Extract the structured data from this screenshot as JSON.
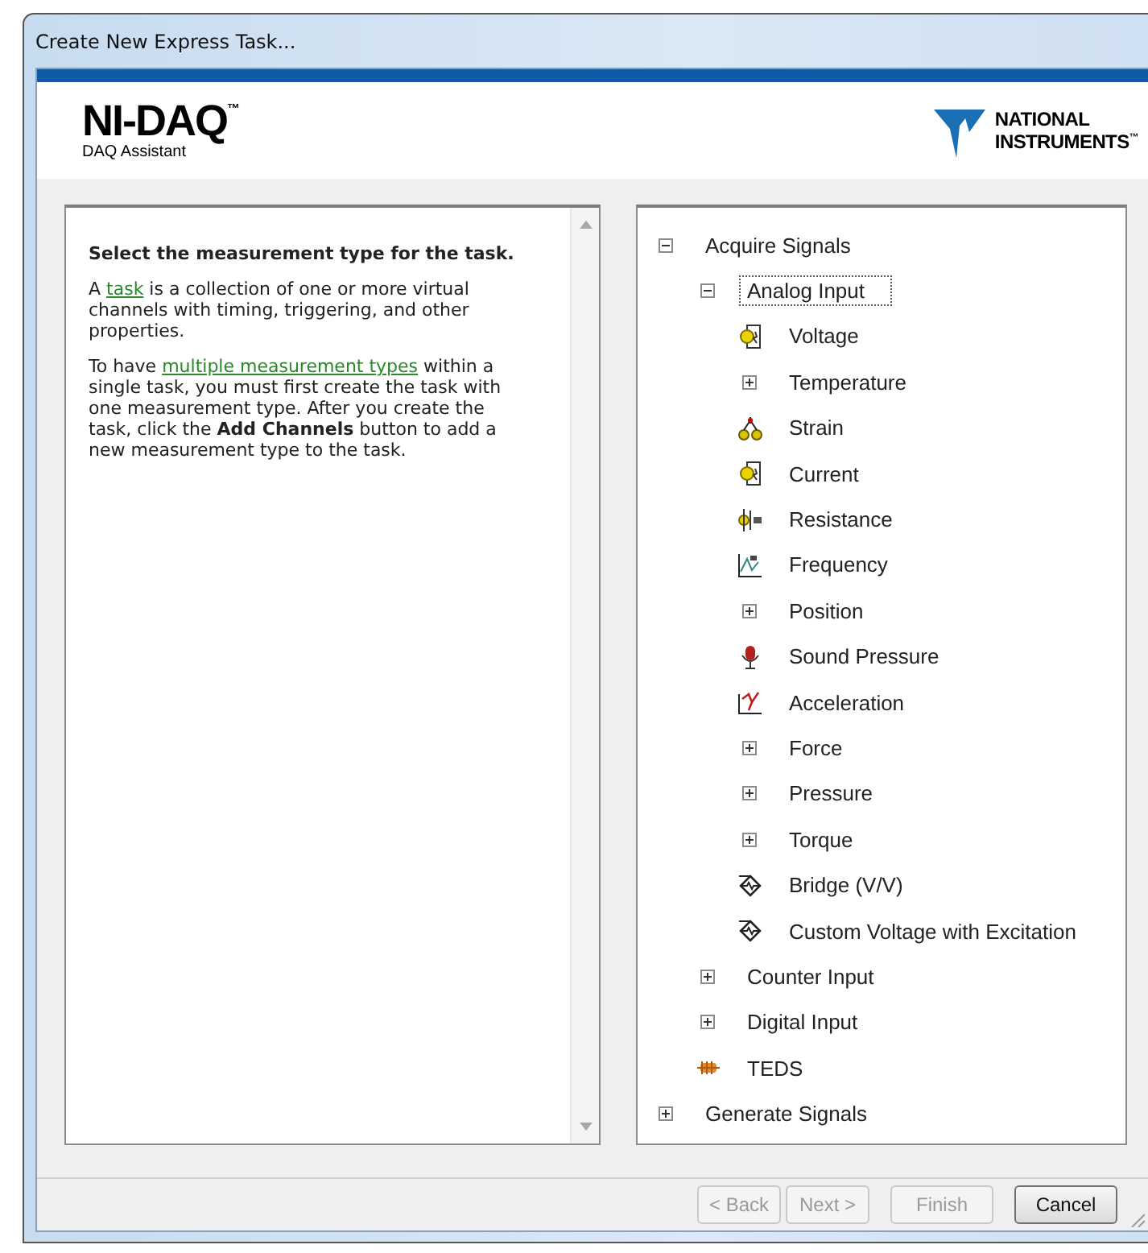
{
  "window": {
    "title": "Create New Express Task..."
  },
  "header": {
    "product": "NI-DAQ",
    "product_mark": "™",
    "subtitle": "DAQ Assistant",
    "brand_lines": [
      "NATIONAL",
      "INSTRUMENTS"
    ],
    "brand_mark": "™"
  },
  "help": {
    "heading": "Select the measurement type for the task.",
    "paragraphs": [
      {
        "parts": [
          {
            "kind": "text",
            "text": "A "
          },
          {
            "kind": "link",
            "text": "task"
          },
          {
            "kind": "text",
            "text": " is a collection of one or more virtual channels with timing, triggering, and other properties."
          }
        ]
      },
      {
        "parts": [
          {
            "kind": "text",
            "text": "To have "
          },
          {
            "kind": "link",
            "text": "multiple measurement types"
          },
          {
            "kind": "text",
            "text": " within a single task, you must first create the task with one measurement type. After you create the task, click the **Add Channels** button to add a new measurement type to the task."
          }
        ]
      }
    ]
  },
  "tree": [
    {
      "label": "Acquire Signals",
      "expanded": true,
      "selected": false,
      "children": [
        {
          "label": "Analog Input",
          "expanded": true,
          "selected": true,
          "children": [
            {
              "label": "Voltage",
              "selected": false
            },
            {
              "label": "Temperature",
              "expanded": false,
              "selected": false
            },
            {
              "label": "Strain",
              "selected": false
            },
            {
              "label": "Current",
              "selected": false
            },
            {
              "label": "Resistance",
              "selected": false
            },
            {
              "label": "Frequency",
              "selected": false
            },
            {
              "label": "Position",
              "expanded": false,
              "selected": false
            },
            {
              "label": "Sound Pressure",
              "selected": false
            },
            {
              "label": "Acceleration",
              "selected": false
            },
            {
              "label": "Force",
              "expanded": false,
              "selected": false
            },
            {
              "label": "Pressure",
              "expanded": false,
              "selected": false
            },
            {
              "label": "Torque",
              "expanded": false,
              "selected": false
            },
            {
              "label": "Bridge (V/V)",
              "selected": false
            },
            {
              "label": "Custom Voltage with Excitation",
              "selected": false
            }
          ]
        },
        {
          "label": "Counter Input",
          "expanded": false,
          "selected": false
        },
        {
          "label": "Digital Input",
          "expanded": false,
          "selected": false
        },
        {
          "label": "TEDS",
          "selected": false
        }
      ]
    },
    {
      "label": "Generate Signals",
      "expanded": false,
      "selected": false
    }
  ],
  "buttons": [
    {
      "label": "< Back",
      "disabled": true
    },
    {
      "label": "Next >",
      "disabled": true
    },
    {
      "label": "Finish",
      "disabled": true
    },
    {
      "label": "Cancel",
      "disabled": false
    }
  ]
}
